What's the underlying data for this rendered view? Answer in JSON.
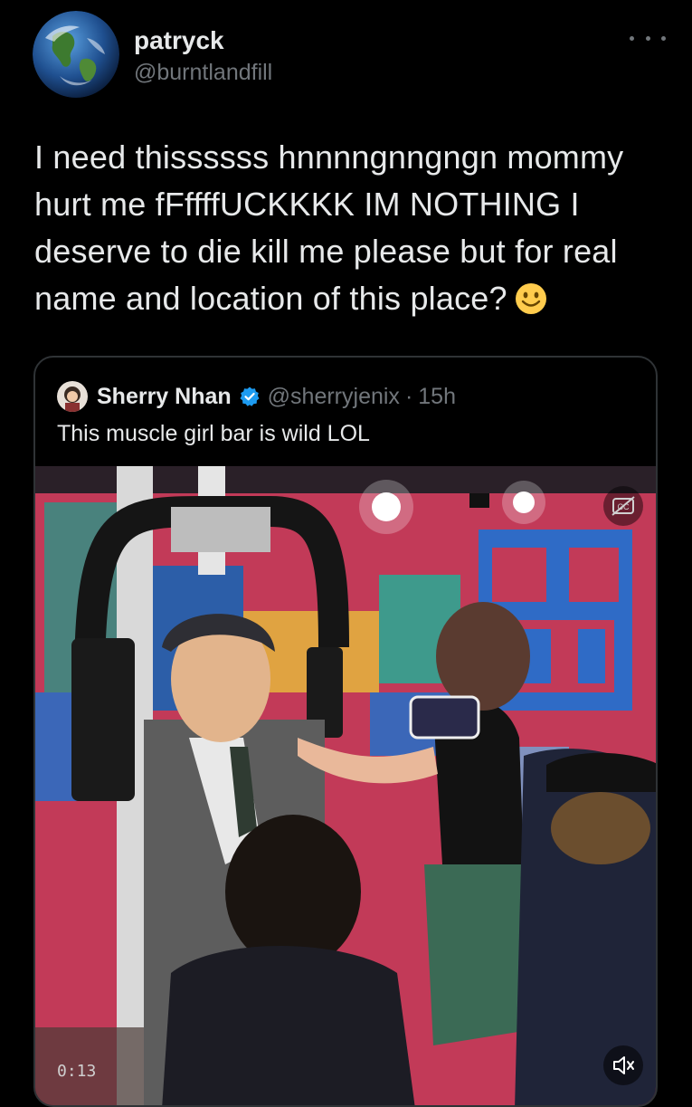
{
  "tweet": {
    "display_name": "patryck",
    "handle": "@burntlandfill",
    "text": "I need thissssss hnnnngnngngn mommy hurt me fFffffUCKKKK IM NOTHING I deserve to die kill me please but for real name and location of this place?",
    "emoji": "slightly-smiling-face"
  },
  "quoted_tweet": {
    "display_name": "Sherry Nhan",
    "verified": true,
    "handle": "@sherryjenix",
    "separator": "·",
    "time": "15h",
    "text": "This muscle girl bar is wild LOL",
    "media": {
      "type": "video",
      "timestamp": "0:13",
      "muted": true
    }
  },
  "colors": {
    "background": "#000000",
    "text_primary": "#e7e9ea",
    "text_secondary": "#71767b",
    "border": "#2f3336",
    "verified": "#1d9bf0"
  }
}
